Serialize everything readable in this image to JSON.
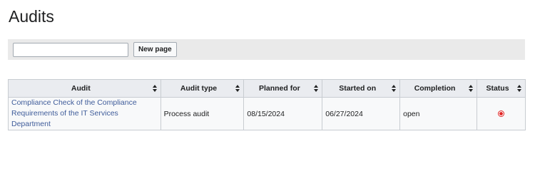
{
  "page": {
    "title": "Audits"
  },
  "toolbar": {
    "input_value": "",
    "new_page_label": "New page"
  },
  "table": {
    "columns": [
      {
        "key": "audit",
        "label": "Audit"
      },
      {
        "key": "audit_type",
        "label": "Audit type"
      },
      {
        "key": "planned_for",
        "label": "Planned for"
      },
      {
        "key": "started_on",
        "label": "Started on"
      },
      {
        "key": "completion",
        "label": "Completion"
      },
      {
        "key": "status",
        "label": "Status"
      }
    ],
    "rows": [
      {
        "audit": "Compliance Check of the Compliance Requirements of the IT Services Department",
        "audit_type": "Process audit",
        "planned_for": "08/15/2024",
        "started_on": "06/27/2024",
        "completion": "open",
        "status_icon": "red-circle-icon"
      }
    ]
  },
  "colors": {
    "link": "#3f5c9a",
    "status_open": "#e02424",
    "header_bg": "#eaecf0",
    "toolbar_bg": "#eaeaea"
  }
}
